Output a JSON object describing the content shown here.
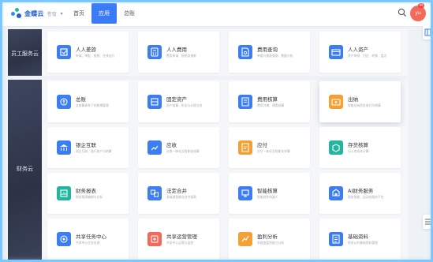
{
  "app": {
    "logo_text": "金蝶云",
    "logo_sub": "苍穹",
    "nav": [
      "首页",
      "应用",
      "总账"
    ],
    "active_nav": 1,
    "avatar_text": "yu",
    "avatar_badge": "99"
  },
  "sections": [
    {
      "label": "员工服务云"
    },
    {
      "label": "财务云"
    }
  ],
  "cards": [
    {
      "title": "人人差旅",
      "desc": "申请、审批、报销、在线出行",
      "color": "#3d7df2",
      "icon": "travel-icon"
    },
    {
      "title": "人人费用",
      "desc": "费用申请、报销及借款",
      "color": "#3d7df2",
      "icon": "calculator-icon"
    },
    {
      "title": "费用查询",
      "desc": "单据与报表查询、数据分析",
      "color": "#3d7df2",
      "icon": "document-search-icon"
    },
    {
      "title": "人人资产",
      "desc": "资产申领、归还、转移、盘点",
      "color": "#3d7df2",
      "icon": "asset-icon"
    },
    {
      "title": "总账",
      "desc": "全核算体系下的账簿管理",
      "color": "#3d7df2",
      "icon": "ledger-icon"
    },
    {
      "title": "固定资产",
      "desc": "资产核算、折旧与计提业务",
      "color": "#3d7df2",
      "icon": "fixed-asset-icon"
    },
    {
      "title": "费用核算",
      "desc": "费用分摊、预提核算",
      "color": "#3d7df2",
      "icon": "expense-icon"
    },
    {
      "title": "出纳",
      "desc": "智能出纳资金收付与结算",
      "color": "#f5a035",
      "icon": "cashier-icon"
    },
    {
      "title": "银企互联",
      "desc": "银企互联、银行账户与结算",
      "color": "#3d7df2",
      "icon": "bank-icon"
    },
    {
      "title": "应收",
      "desc": "应收一体化及智能化核算",
      "color": "#3d7df2",
      "icon": "receivable-icon"
    },
    {
      "title": "应付",
      "desc": "应付一体化及智能化核算",
      "color": "#f5a035",
      "icon": "payable-icon"
    },
    {
      "title": "存货核算",
      "desc": "出入库成本计算",
      "color": "#23b5a0",
      "icon": "inventory-icon"
    },
    {
      "title": "财务报表",
      "desc": "财务报表编制与分析",
      "color": "#23b5a0",
      "icon": "report-icon"
    },
    {
      "title": "法定合并",
      "desc": "多维度智能化合并报表",
      "color": "#3d7df2",
      "icon": "merge-icon"
    },
    {
      "title": "智能核算",
      "desc": "智能财务机器人",
      "color": "#3d7df2",
      "icon": "smart-account-icon"
    },
    {
      "title": "AI财务服务",
      "desc": "财务智能、自动化服务平台",
      "color": "#3d7df2",
      "icon": "ai-icon"
    },
    {
      "title": "共享任务中心",
      "desc": "共享中心任务处理",
      "color": "#3d7df2",
      "icon": "task-center-icon"
    },
    {
      "title": "共享运营管理",
      "desc": "共享中心运营与监控",
      "color": "#f36a5a",
      "icon": "operation-icon"
    },
    {
      "title": "盈利分析",
      "desc": "多维度盈利能力分析",
      "color": "#f5a035",
      "icon": "profit-icon"
    },
    {
      "title": "基础资料",
      "desc": "财务公共基础资料管理",
      "color": "#3d7df2",
      "icon": "basic-data-icon"
    }
  ]
}
